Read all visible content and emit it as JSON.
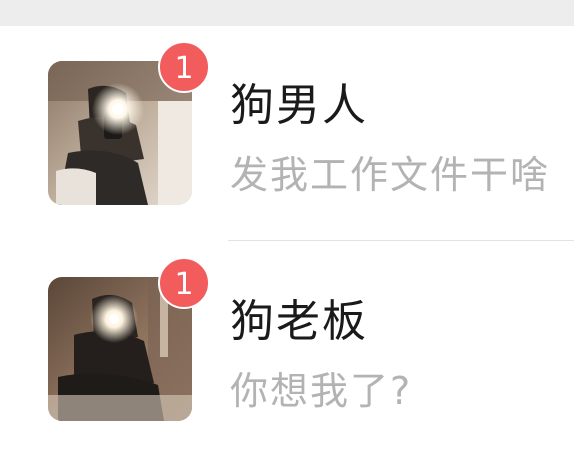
{
  "chats": [
    {
      "name": "狗男人",
      "preview": "发我工作文件干啥",
      "unread": "1",
      "avatar_icon": "avatar-mirror-selfie-icon"
    },
    {
      "name": "狗老板",
      "preview": "你想我了?",
      "unread": "1",
      "avatar_icon": "avatar-mirror-selfie-icon"
    }
  ],
  "colors": {
    "badge": "#f25c5c",
    "name": "#1a1a1a",
    "preview": "#b3b3b3",
    "top_strip": "#ededed"
  }
}
